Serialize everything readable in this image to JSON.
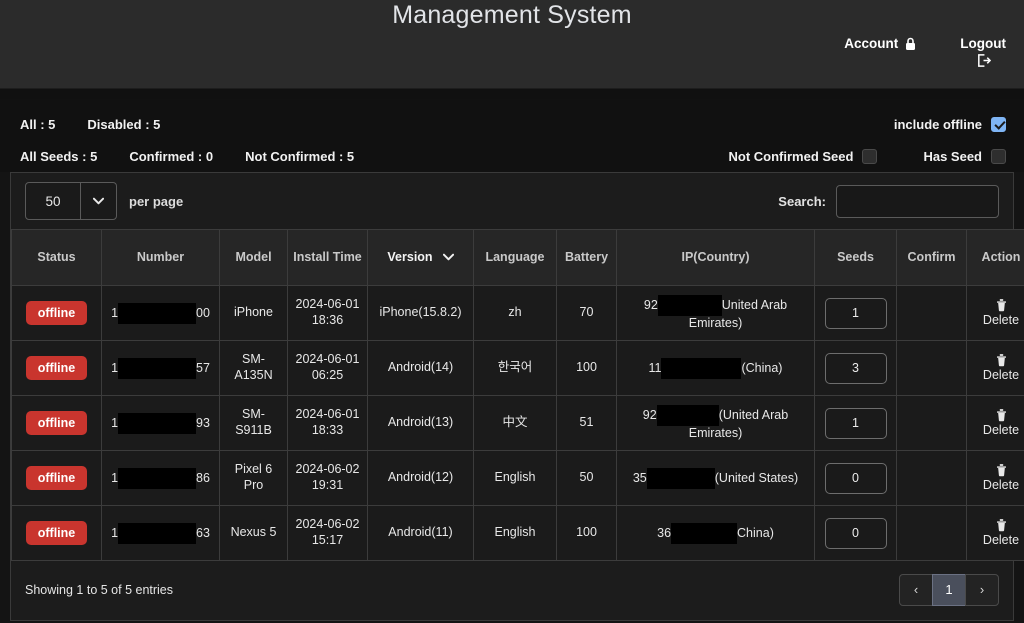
{
  "header": {
    "title": "Management System",
    "account_label": "Account",
    "account_icon": "lock-icon",
    "logout_label": "Logout",
    "logout_icon": "sign-out-icon"
  },
  "stats": {
    "row1": [
      {
        "label": "All : 5"
      },
      {
        "label": "Disabled : 5"
      }
    ],
    "row2": [
      {
        "label": "All Seeds : 5"
      },
      {
        "label": "Confirmed : 0"
      },
      {
        "label": "Not Confirmed : 5"
      }
    ],
    "include_offline": {
      "label": "include offline",
      "checked": true
    },
    "not_confirmed_seed": {
      "label": "Not Confirmed Seed",
      "checked": false
    },
    "has_seed": {
      "label": "Has Seed",
      "checked": false
    }
  },
  "toolbar": {
    "per_page_value": "50",
    "per_page_label": "per page",
    "caret_icon": "chevron-down-icon",
    "search_label": "Search:",
    "search_value": "",
    "search_placeholder": ""
  },
  "table": {
    "columns": [
      {
        "label": "Status",
        "sorted": false
      },
      {
        "label": "Number",
        "sorted": false
      },
      {
        "label": "Model",
        "sorted": false
      },
      {
        "label": "Install Time",
        "sorted": false
      },
      {
        "label": "Version",
        "sorted": true,
        "icon": "chevron-down-icon"
      },
      {
        "label": "Language",
        "sorted": false
      },
      {
        "label": "Battery",
        "sorted": false
      },
      {
        "label": "IP(Country)",
        "sorted": false
      },
      {
        "label": "Seeds",
        "sorted": false
      },
      {
        "label": "Confirm",
        "sorted": false
      },
      {
        "label": "Action",
        "sorted": false
      }
    ],
    "rows": [
      {
        "status": "offline",
        "number_prefix": "1",
        "number_suffix": "00",
        "number_redact_width": 78,
        "model": "iPhone",
        "install_time": "2024-06-01 18:36",
        "version": "iPhone(15.8.2)",
        "language": "zh",
        "battery": "70",
        "ip_prefix": "92",
        "ip_redact_width": 64,
        "ip_country": "United Arab Emirates)",
        "seeds": "1",
        "confirm": "",
        "action_label": "Delete",
        "action_icon": "trash-icon"
      },
      {
        "status": "offline",
        "number_prefix": "1",
        "number_suffix": "57",
        "number_redact_width": 78,
        "model": "SM-A135N",
        "install_time": "2024-06-01 06:25",
        "version": "Android(14)",
        "language": "한국어",
        "battery": "100",
        "ip_prefix": "11",
        "ip_redact_width": 80,
        "ip_country": "(China)",
        "seeds": "3",
        "confirm": "",
        "action_label": "Delete",
        "action_icon": "trash-icon"
      },
      {
        "status": "offline",
        "number_prefix": "1",
        "number_suffix": "93",
        "number_redact_width": 78,
        "model": "SM-S911B",
        "install_time": "2024-06-01 18:33",
        "version": "Android(13)",
        "language": "中文",
        "battery": "51",
        "ip_prefix": "92",
        "ip_redact_width": 62,
        "ip_country": "(United Arab Emirates)",
        "seeds": "1",
        "confirm": "",
        "action_label": "Delete",
        "action_icon": "trash-icon"
      },
      {
        "status": "offline",
        "number_prefix": "1",
        "number_suffix": "86",
        "number_redact_width": 78,
        "model": "Pixel 6 Pro",
        "install_time": "2024-06-02 19:31",
        "version": "Android(12)",
        "language": "English",
        "battery": "50",
        "ip_prefix": "35",
        "ip_redact_width": 68,
        "ip_country": "(United States)",
        "seeds": "0",
        "confirm": "",
        "action_label": "Delete",
        "action_icon": "trash-icon"
      },
      {
        "status": "offline",
        "number_prefix": "1",
        "number_suffix": "63",
        "number_redact_width": 78,
        "model": "Nexus 5",
        "install_time": "2024-06-02 15:17",
        "version": "Android(11)",
        "language": "English",
        "battery": "100",
        "ip_prefix": "36",
        "ip_redact_width": 66,
        "ip_country": "China)",
        "seeds": "0",
        "confirm": "",
        "action_label": "Delete",
        "action_icon": "trash-icon"
      }
    ]
  },
  "footer": {
    "showing": "Showing 1 to 5 of 5 entries",
    "pagination": {
      "prev": "‹",
      "pages": [
        "1"
      ],
      "active_page": "1",
      "next": "›"
    }
  },
  "colors": {
    "offline_badge": "#c9352e",
    "checkbox_on": "#7fb5f5",
    "header_bg": "#2b2b2b",
    "page_bg": "#141414",
    "active_page": "#4a4f5c"
  }
}
